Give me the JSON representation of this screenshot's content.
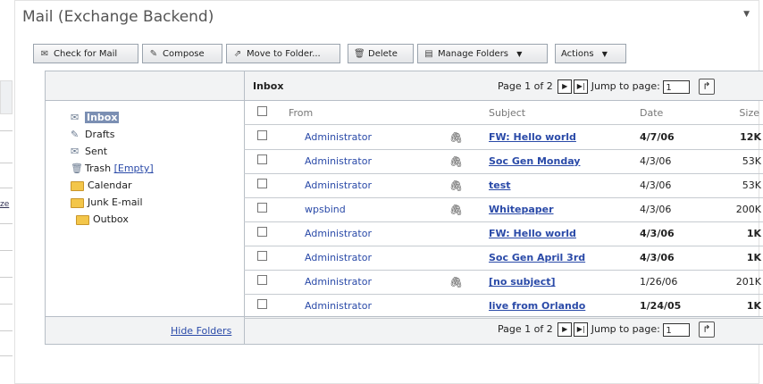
{
  "portlet": {
    "title": "Mail (Exchange Backend)",
    "menu_icon": "dropdown-arrow"
  },
  "left_fragment": "ze",
  "toolbar": {
    "check_mail": "Check for Mail",
    "compose": "Compose",
    "move": "Move to Folder...",
    "delete": "Delete",
    "manage": "Manage Folders",
    "actions": "Actions"
  },
  "header": {
    "inbox_title": "Inbox",
    "page_text": "Page 1 of 2",
    "jump_label": "Jump to page:",
    "jump_value": "1"
  },
  "footer": {
    "hide_folders": "Hide Folders",
    "page_text": "Page 1 of 2",
    "jump_label": "Jump to page:",
    "jump_value": "1"
  },
  "folders": {
    "inbox": "Inbox",
    "drafts": "Drafts",
    "sent": "Sent",
    "trash": "Trash",
    "trash_empty": "[Empty]",
    "calendar": "Calendar",
    "junk": "Junk E-mail",
    "outbox": "Outbox"
  },
  "columns": {
    "from": "From",
    "subject": "Subject",
    "date": "Date",
    "size": "Size"
  },
  "messages": [
    {
      "from": "Administrator",
      "attachment": true,
      "subject": "FW: Hello world",
      "date": "4/7/06",
      "size": "12K",
      "unread": true
    },
    {
      "from": "Administrator",
      "attachment": true,
      "subject": "Soc Gen Monday",
      "date": "4/3/06",
      "size": "53K",
      "unread": false
    },
    {
      "from": "Administrator",
      "attachment": true,
      "subject": "test",
      "date": "4/3/06",
      "size": "53K",
      "unread": false
    },
    {
      "from": "wpsbind",
      "attachment": true,
      "subject": "Whitepaper",
      "date": "4/3/06",
      "size": "200K",
      "unread": false
    },
    {
      "from": "Administrator",
      "attachment": false,
      "subject": "FW: Hello world",
      "date": "4/3/06",
      "size": "1K",
      "unread": true
    },
    {
      "from": "Administrator",
      "attachment": false,
      "subject": "Soc Gen April 3rd",
      "date": "4/3/06",
      "size": "1K",
      "unread": true
    },
    {
      "from": "Administrator",
      "attachment": true,
      "subject": "[no subject]",
      "date": "1/26/06",
      "size": "201K",
      "unread": false
    },
    {
      "from": "Administrator",
      "attachment": false,
      "subject": "live from Orlando",
      "date": "1/24/05",
      "size": "1K",
      "unread": true
    }
  ]
}
